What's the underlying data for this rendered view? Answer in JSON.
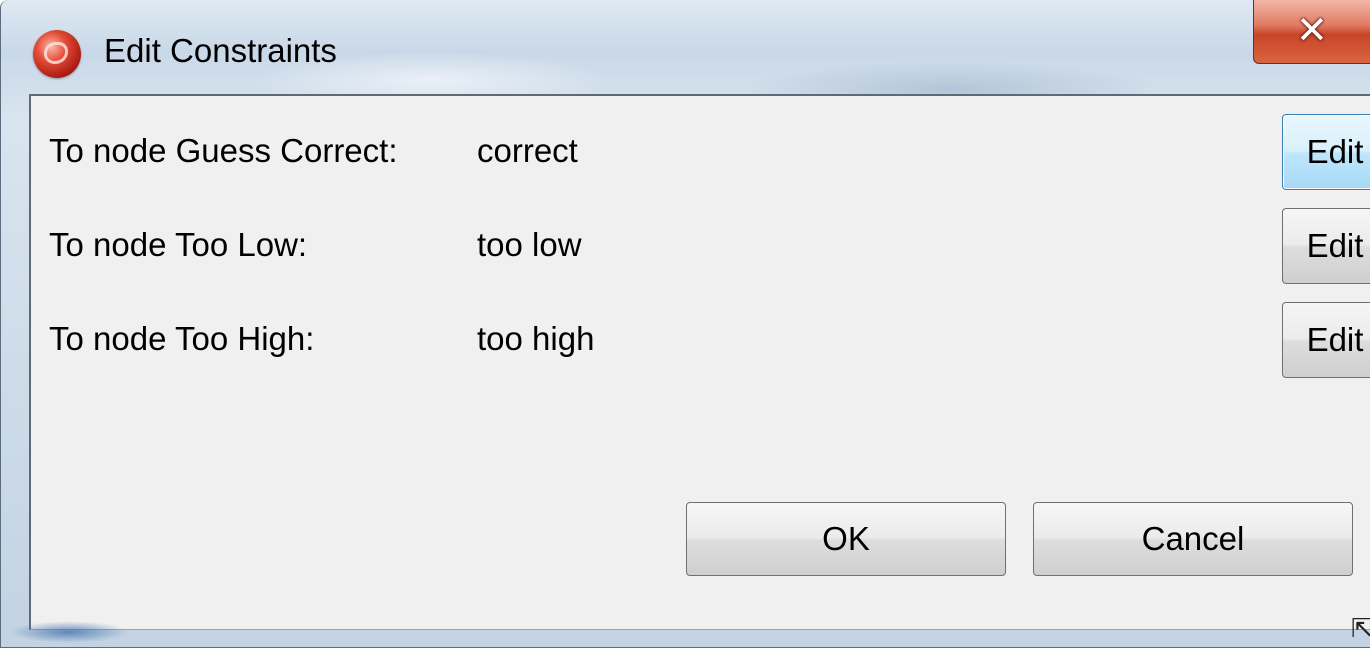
{
  "window": {
    "title": "Edit Constraints",
    "close_label": "✕",
    "icon": "app-logo-icon"
  },
  "rows": [
    {
      "label": "To node Guess Correct:",
      "value": "correct",
      "button": "Edit"
    },
    {
      "label": "To node Too Low:",
      "value": "too low",
      "button": "Edit"
    },
    {
      "label": "To node Too High:",
      "value": "too high",
      "button": "Edit"
    }
  ],
  "footer": {
    "ok_label": "OK",
    "cancel_label": "Cancel"
  },
  "resize_grip": "⇱",
  "colors": {
    "client_bg": "#f0f0f0",
    "focus_border": "#3c7fb1",
    "close_red": "#c8452a"
  }
}
